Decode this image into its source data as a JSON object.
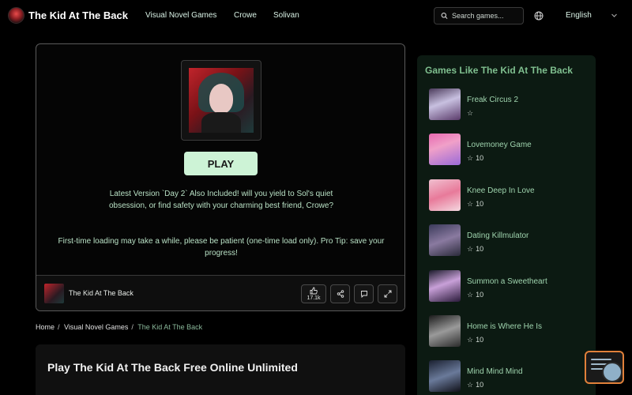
{
  "header": {
    "site_title": "The Kid At The Back",
    "nav": [
      "Visual Novel Games",
      "Crowe",
      "Solivan"
    ],
    "search_placeholder": "Search games...",
    "language": "English"
  },
  "game": {
    "play_label": "PLAY",
    "description": "Latest Version `Day 2` Also Included! will you yield to Sol's quiet obsession, or find safety with your charming best friend, Crowe?",
    "tip": "First-time loading may take a while, please be patient (one-time load only). Pro Tip: save your progress!",
    "footer_title": "The Kid At The Back",
    "likes": "17.1k"
  },
  "breadcrumb": {
    "home": "Home",
    "category": "Visual Novel Games",
    "current": "The Kid At The Back"
  },
  "info": {
    "title": "Play The Kid At The Back Free Online Unlimited"
  },
  "sidebar": {
    "title": "Games Like The Kid At The Back",
    "items": [
      {
        "name": "Freak Circus 2",
        "rating": ""
      },
      {
        "name": "Lovemoney Game",
        "rating": "10"
      },
      {
        "name": "Knee Deep In Love",
        "rating": "10"
      },
      {
        "name": "Dating Killmulator",
        "rating": "10"
      },
      {
        "name": "Summon a Sweetheart",
        "rating": "10"
      },
      {
        "name": "Home is Where He Is",
        "rating": "10"
      },
      {
        "name": "Mind Mind Mind",
        "rating": "10"
      }
    ]
  },
  "colors": {
    "accent": "#cdf3d6",
    "sidebar_bg": "#0c1a12",
    "sidebar_title": "#7fbf8f",
    "item_name": "#9fd4ae",
    "widget_border": "#e0803a"
  }
}
